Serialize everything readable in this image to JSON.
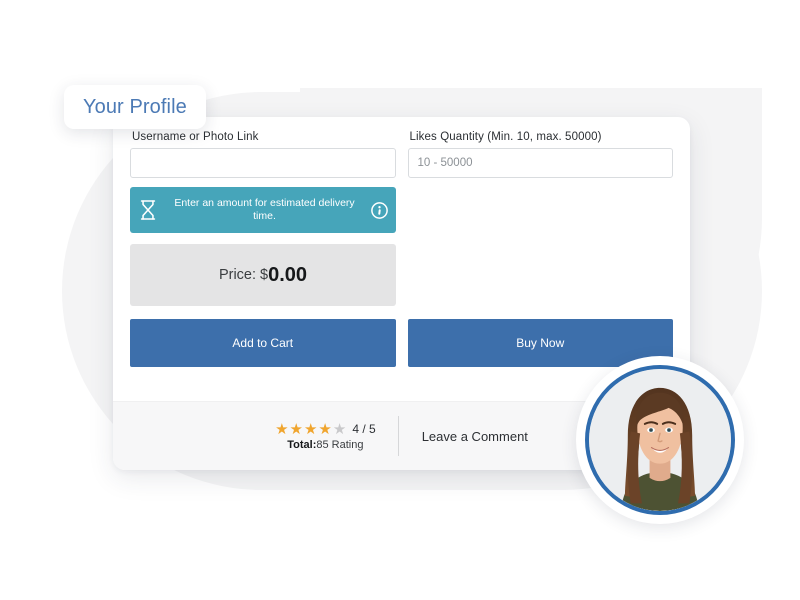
{
  "tab": {
    "label": "Your Profile"
  },
  "form": {
    "username_field": {
      "label": "Username or Photo Link",
      "value": "",
      "placeholder": ""
    },
    "likes_field": {
      "label": "Likes Quantity (Min. 10, max. 50000)",
      "value": "",
      "placeholder": "10 - 50000"
    }
  },
  "notice": {
    "text": "Enter an amount for estimated delivery time.",
    "icon_left": "hourglass-icon",
    "icon_right": "info-icon",
    "background_color": "#46a5ba"
  },
  "price": {
    "label": "Price: $",
    "value": "0.00"
  },
  "actions": {
    "add_to_cart": "Add to Cart",
    "buy_now": "Buy Now",
    "button_color": "#3d6fab"
  },
  "rating": {
    "stars_filled": 4,
    "stars_total": 5,
    "star_glyph": "★",
    "star_color": "#f0a52e",
    "star_empty_color": "#c9c9cb",
    "score_text": "4 / 5",
    "total_prefix": "Total:",
    "total_value": "85 Rating",
    "comment_link": "Leave a Comment"
  },
  "avatar": {
    "alt": "profile-photo",
    "ring_color": "#2f6cae"
  }
}
